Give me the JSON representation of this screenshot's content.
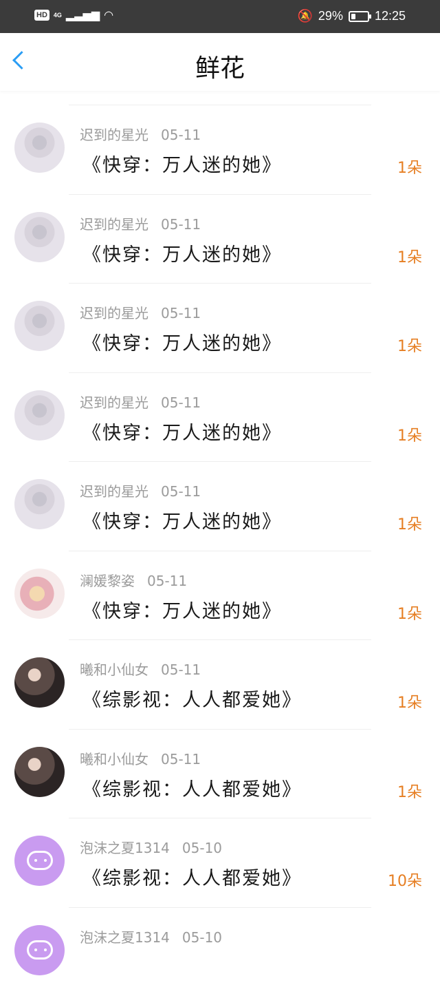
{
  "status_bar": {
    "hd": "HD",
    "network": "4G",
    "battery_text": "29%",
    "battery_level": 0.29,
    "time": "12:25"
  },
  "header": {
    "title": "鲜花",
    "back_icon": "chevron-left-icon"
  },
  "items": [
    {
      "user": "迟到的星光",
      "date": "05-11",
      "book": "《快穿：万人迷的她》",
      "count": "1朵"
    },
    {
      "user": "迟到的星光",
      "date": "05-11",
      "book": "《快穿：万人迷的她》",
      "count": "1朵"
    },
    {
      "user": "迟到的星光",
      "date": "05-11",
      "book": "《快穿：万人迷的她》",
      "count": "1朵"
    },
    {
      "user": "迟到的星光",
      "date": "05-11",
      "book": "《快穿：万人迷的她》",
      "count": "1朵"
    },
    {
      "user": "迟到的星光",
      "date": "05-11",
      "book": "《快穿：万人迷的她》",
      "count": "1朵"
    },
    {
      "user": "澜媛黎姿",
      "date": "05-11",
      "book": "《快穿：万人迷的她》",
      "count": "1朵"
    },
    {
      "user": "曦和小仙女",
      "date": "05-11",
      "book": "《综影视：人人都爱她》",
      "count": "1朵"
    },
    {
      "user": "曦和小仙女",
      "date": "05-11",
      "book": "《综影视：人人都爱她》",
      "count": "1朵"
    },
    {
      "user": "泡沫之夏1314",
      "date": "05-10",
      "book": "《综影视：人人都爱她》",
      "count": "10朵"
    },
    {
      "user": "泡沫之夏1314",
      "date": "05-10",
      "book": "",
      "count": ""
    }
  ],
  "colors": {
    "accent": "#2a9df4",
    "count": "#e67e22",
    "status_bg": "#3b3b3b"
  }
}
